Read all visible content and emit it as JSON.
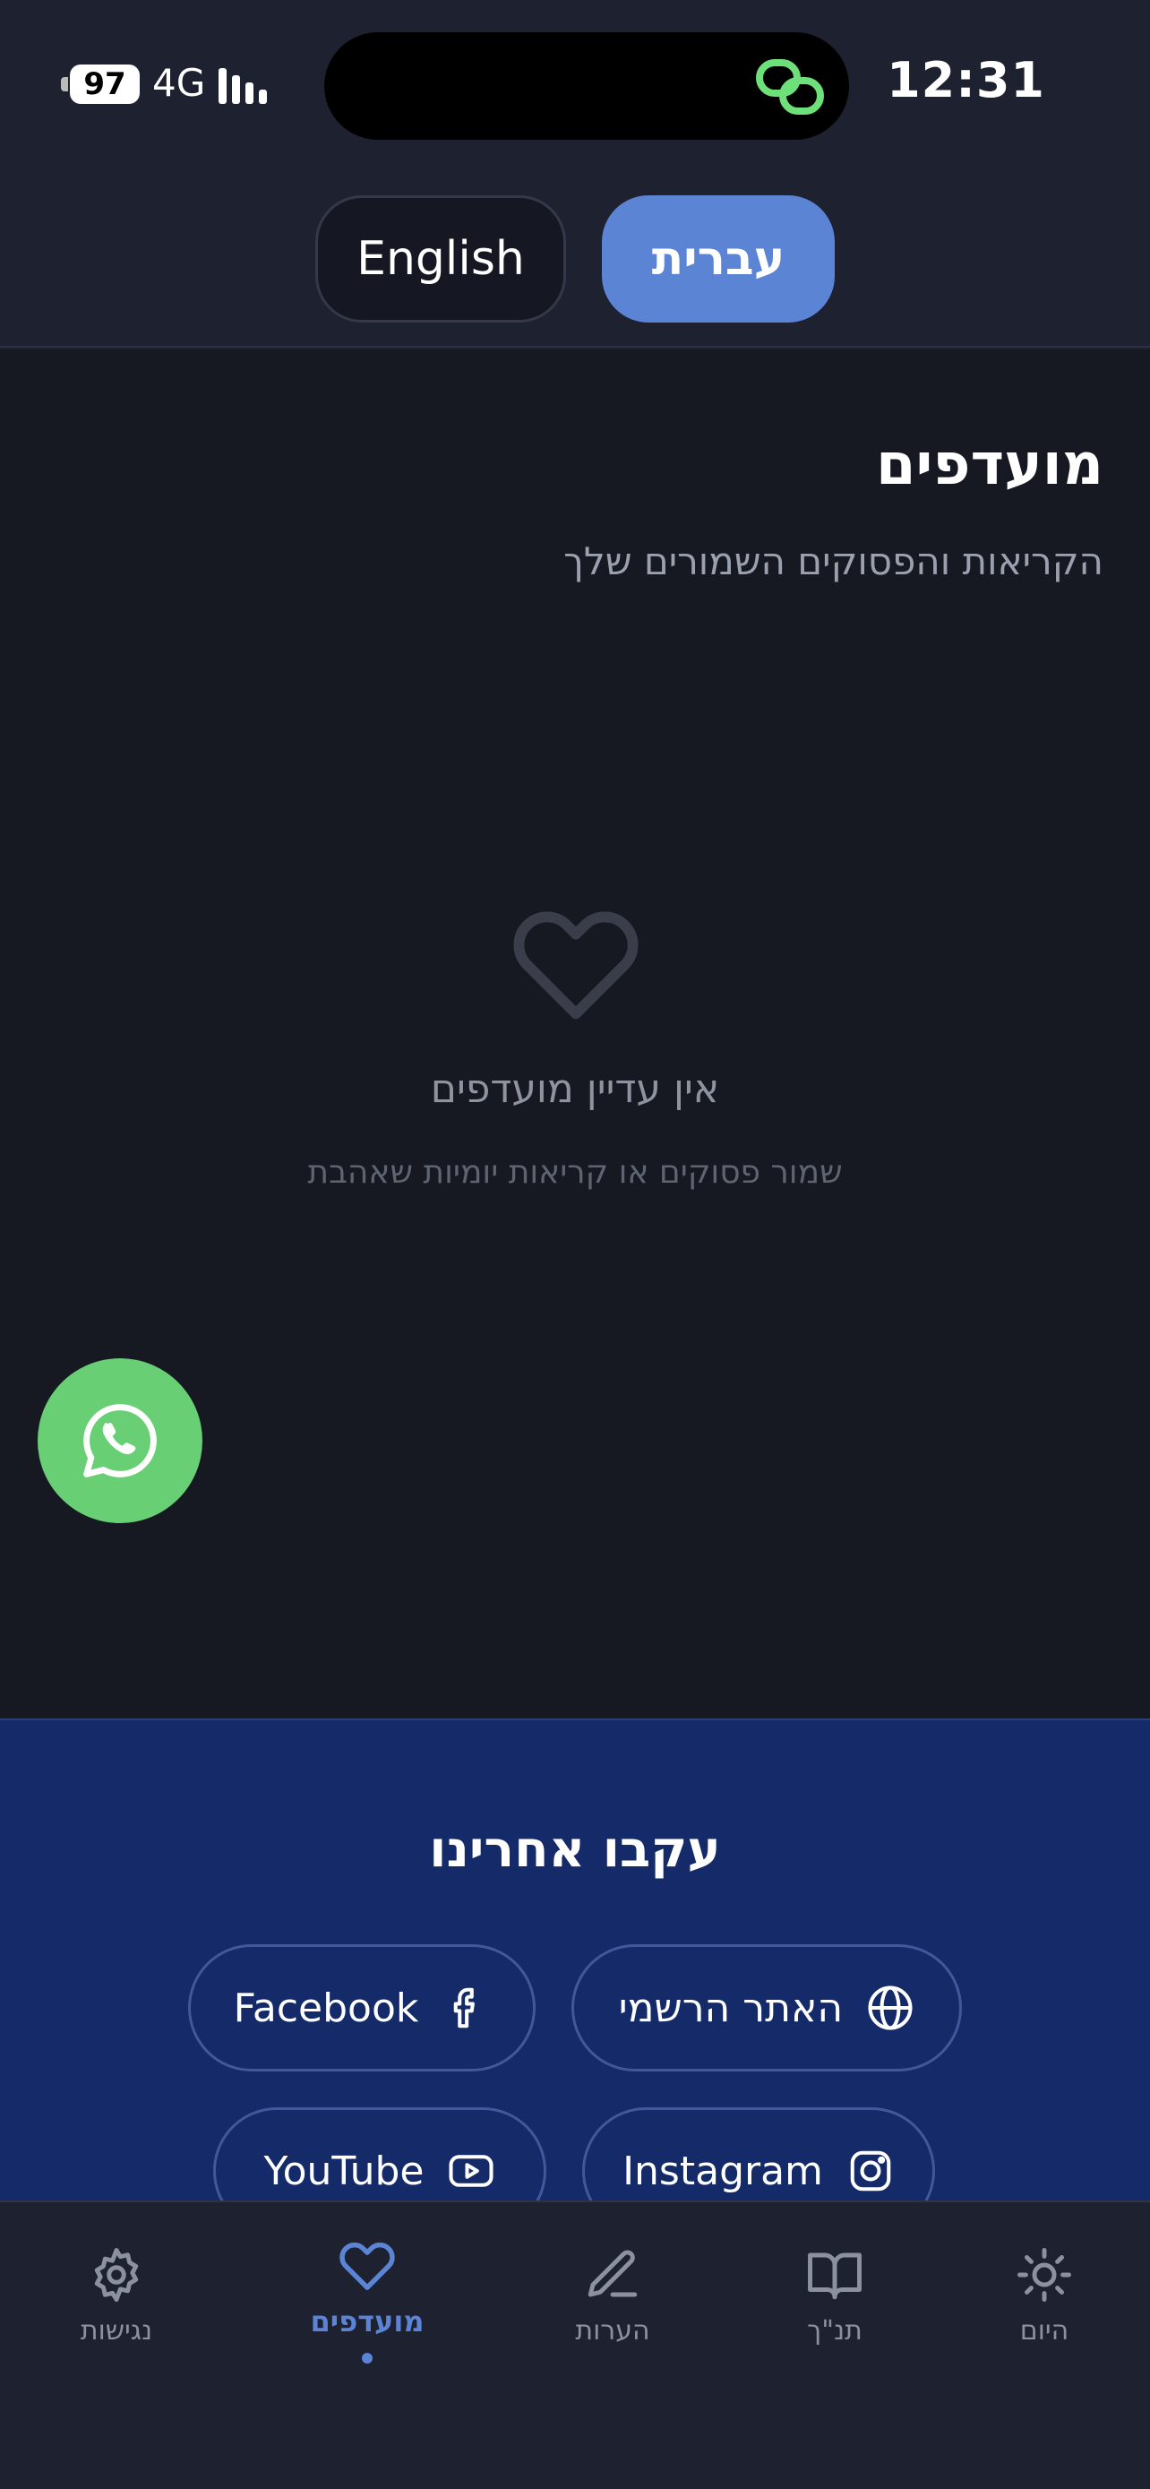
{
  "status_bar": {
    "time": "12:31",
    "battery": "97",
    "network": "4G",
    "dynamic_island_icon": "link-icon"
  },
  "language_toggle": {
    "english_label": "English",
    "hebrew_label": "עברית",
    "selected": "hebrew"
  },
  "page": {
    "title": "מועדפים",
    "subtitle": "הקריאות והפסוקים השמורים שלך"
  },
  "empty_state": {
    "icon": "heart-icon",
    "title": "אין עדיין מועדפים",
    "subtitle": "שמור פסוקים או קריאות יומיות שאהבת"
  },
  "whatsapp": {
    "icon": "whatsapp-icon"
  },
  "follow": {
    "title": "עקבו אחרינו",
    "links": {
      "website": {
        "label": "האתר הרשמי",
        "icon": "globe-icon"
      },
      "facebook": {
        "label": "Facebook",
        "icon": "facebook-icon"
      },
      "instagram": {
        "label": "Instagram",
        "icon": "instagram-icon"
      },
      "youtube": {
        "label": "YouTube",
        "icon": "youtube-icon"
      }
    }
  },
  "bottom_nav": {
    "items": [
      {
        "label": "היום",
        "icon": "sun-icon"
      },
      {
        "label": "תנ\"ך",
        "icon": "book-icon"
      },
      {
        "label": "הערות",
        "icon": "pencil-icon"
      },
      {
        "label": "מועדפים",
        "icon": "heart-icon",
        "active": true
      },
      {
        "label": "נגישות",
        "icon": "gear-icon"
      }
    ]
  },
  "colors": {
    "accent": "#5b84d4",
    "background": "#161922",
    "surface": "#1e2130",
    "follow_background": "#142a69",
    "whatsapp": "#68cf75"
  }
}
